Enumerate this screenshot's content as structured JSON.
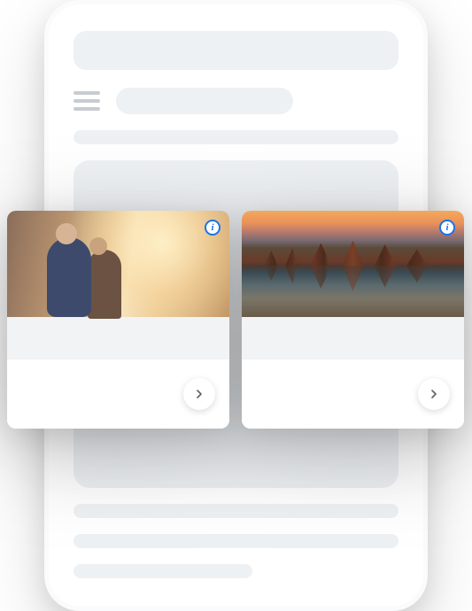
{
  "cards": [
    {
      "image_semantic": "couple-tourists-temple-sunset",
      "info_badge": "i",
      "chevron_icon": "chevron-right-icon"
    },
    {
      "image_semantic": "thai-temple-water-reflection-sunset",
      "info_badge": "i",
      "chevron_icon": "chevron-right-icon"
    }
  ],
  "icons": {
    "hamburger": "hamburger-menu-icon",
    "info": "info-icon",
    "chevron": "chevron-right-icon"
  }
}
